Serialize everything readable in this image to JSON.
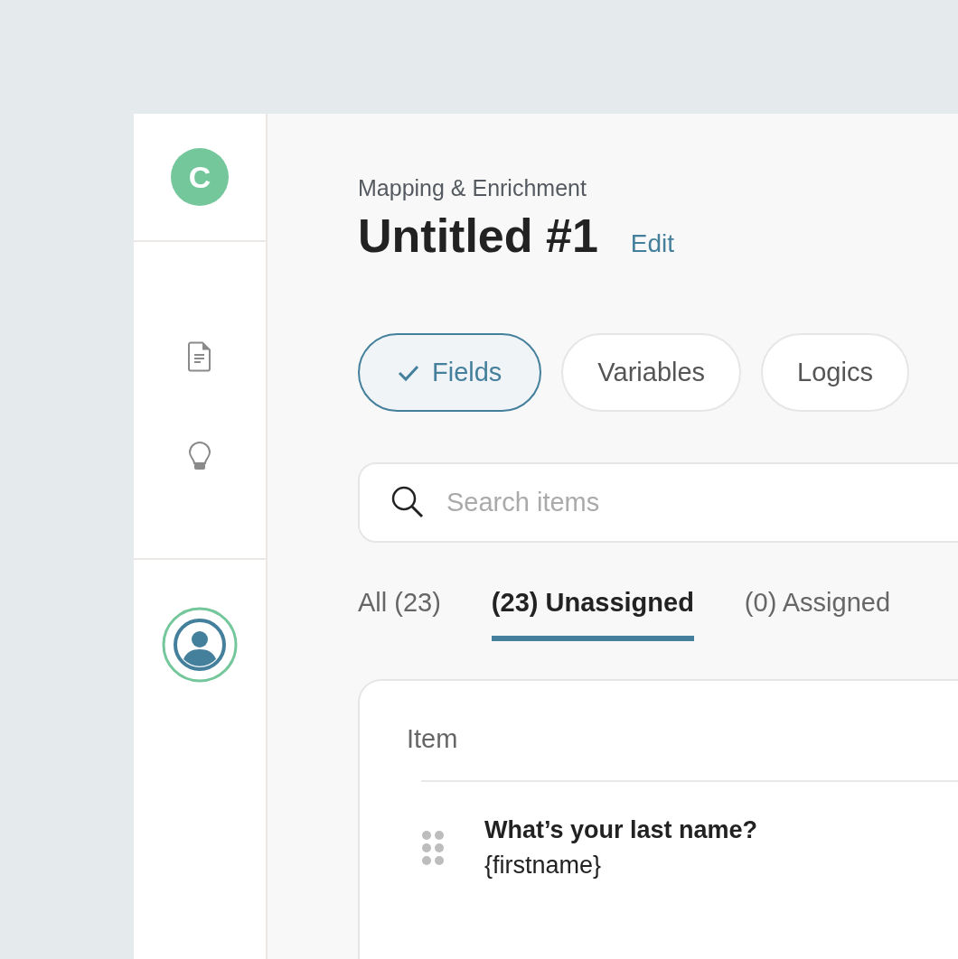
{
  "sidebar": {
    "workspace_initial": "C"
  },
  "header": {
    "subtitle": "Mapping & Enrichment",
    "title": "Untitled #1",
    "edit_link": "Edit"
  },
  "filters": [
    {
      "label": "Fields",
      "selected": true
    },
    {
      "label": "Variables",
      "selected": false
    },
    {
      "label": "Logics",
      "selected": false
    }
  ],
  "search": {
    "placeholder": "Search items"
  },
  "tabs": [
    {
      "label": "All (23)",
      "selected": false
    },
    {
      "label": "(23) Unassigned",
      "selected": true
    },
    {
      "label": "(0) Assigned",
      "selected": false
    }
  ],
  "table": {
    "columns": [
      "Item"
    ],
    "rows": [
      {
        "question": "What’s your last name?",
        "variable": "{firstname}"
      }
    ]
  }
}
